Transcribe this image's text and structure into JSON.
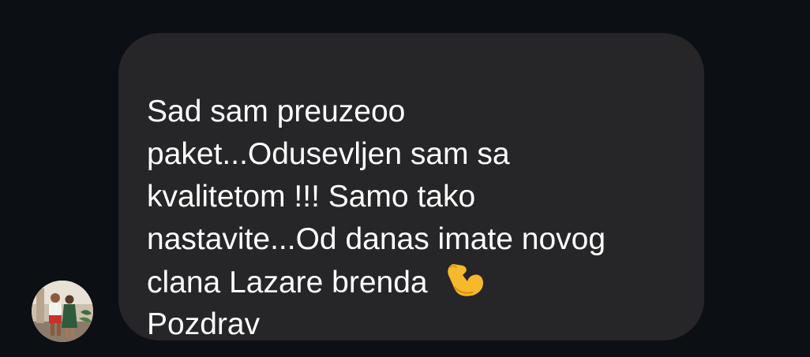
{
  "conversation": {
    "sender_avatar_icon": "user-avatar-photo",
    "message": {
      "lines": [
        "Sad sam preuzeoo",
        "paket...Odusevljen sam sa",
        "kvalitetom !!! Samo tako",
        "nastavite...Od danas imate novog",
        "clana Lazare brenda",
        "Pozdrav"
      ],
      "emoji": "flexed-biceps-icon"
    }
  },
  "colors": {
    "background": "#0c0f14",
    "bubble": "#262628",
    "text": "#ffffff"
  }
}
